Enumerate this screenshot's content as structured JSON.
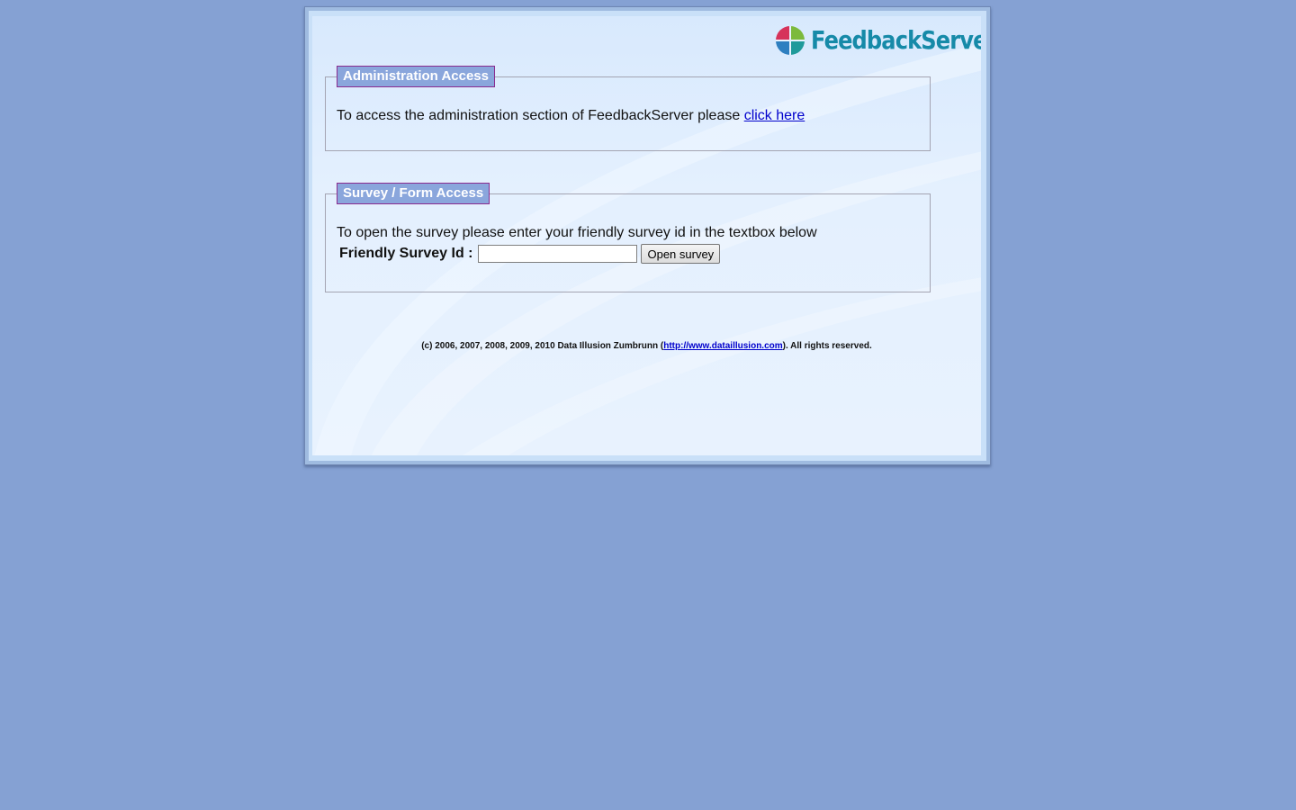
{
  "brand": {
    "name": "FeedbackServer",
    "colors": {
      "text": "#168aa8",
      "pie_red": "#d6335a",
      "pie_green": "#7cba3c",
      "pie_blue": "#2e7fc0",
      "pie_teal": "#1f9a9a"
    }
  },
  "admin_section": {
    "legend": "Administration Access",
    "text": "To access the administration section of FeedbackServer please ",
    "link_label": "click here"
  },
  "survey_section": {
    "legend": "Survey / Form Access",
    "instructions": "To open the survey please enter your friendly survey id in the textbox below",
    "field_label": "Friendly Survey Id :",
    "field_value": "",
    "button_label": "Open survey"
  },
  "footer": {
    "prefix": "(c) 2006, 2007, 2008, 2009, 2010 Data Illusion Zumbrunn (",
    "link_label": "http://www.dataillusion.com",
    "suffix": "). All rights reserved."
  },
  "colors": {
    "page_background": "#85a1d3",
    "legend_background": "#8aa6dc",
    "legend_border": "#8a2b8f",
    "link": "#0000cc"
  }
}
